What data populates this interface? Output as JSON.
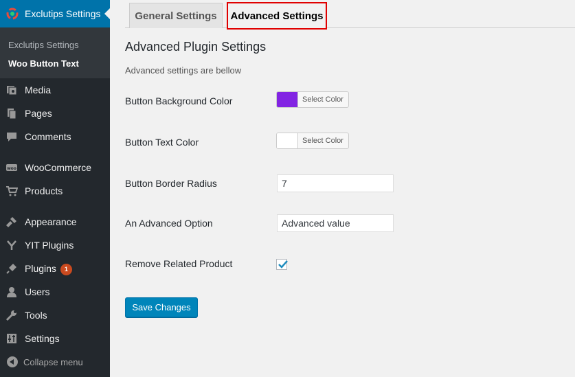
{
  "sidebar": {
    "active_menu": "Exclutips Settings",
    "submenu": [
      "Exclutips Settings",
      "Woo Button Text"
    ],
    "items": [
      {
        "label": "Media",
        "icon": "media-icon"
      },
      {
        "label": "Pages",
        "icon": "pages-icon"
      },
      {
        "label": "Comments",
        "icon": "comments-icon"
      },
      {
        "label": "WooCommerce",
        "icon": "woocommerce-icon"
      },
      {
        "label": "Products",
        "icon": "products-icon"
      },
      {
        "label": "Appearance",
        "icon": "appearance-icon"
      },
      {
        "label": "YIT Plugins",
        "icon": "yit-icon"
      },
      {
        "label": "Plugins",
        "icon": "plugins-icon",
        "badge": "1"
      },
      {
        "label": "Users",
        "icon": "users-icon"
      },
      {
        "label": "Tools",
        "icon": "tools-icon"
      },
      {
        "label": "Settings",
        "icon": "settings-icon"
      }
    ],
    "collapse_label": "Collapse menu"
  },
  "tabs": [
    "General Settings",
    "Advanced Settings"
  ],
  "active_tab": "Advanced Settings",
  "heading": "Advanced Plugin Settings",
  "description": "Advanced settings are bellow",
  "fields": {
    "bg_color": {
      "label": "Button Background Color",
      "button": "Select Color",
      "color": "#8224e3"
    },
    "text_color": {
      "label": "Button Text Color",
      "button": "Select Color",
      "color": "#ffffff"
    },
    "border_radius": {
      "label": "Button Border Radius",
      "value": "7"
    },
    "advanced_option": {
      "label": "An Advanced Option",
      "value": "Advanced value"
    },
    "remove_related": {
      "label": "Remove Related Product",
      "checked": true
    }
  },
  "save_label": "Save Changes",
  "colors": {
    "accent": "#0073aa",
    "sidebar": "#23282d",
    "highlight_border": "#e00000"
  }
}
